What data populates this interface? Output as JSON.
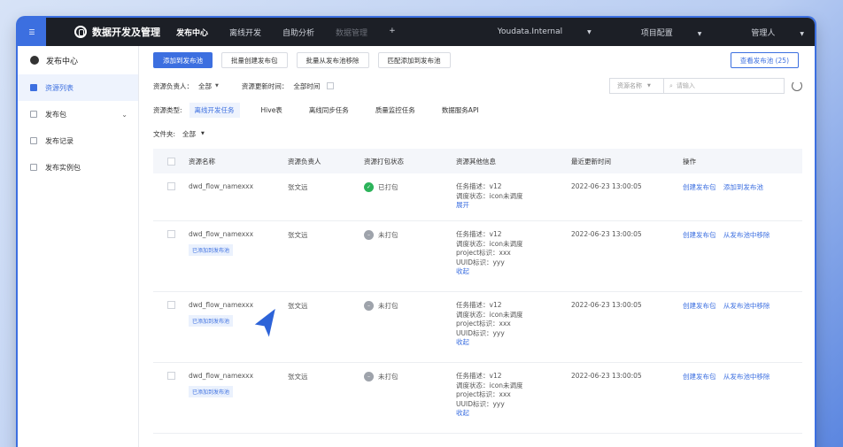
{
  "topbar": {
    "brand": "数据开发及管理",
    "nav": [
      "发布中心",
      "离线开发",
      "自助分析",
      "数据管理",
      "+"
    ],
    "env": "Youdata.Internal",
    "project": "项目配置",
    "user": "管理人"
  },
  "sidebar": {
    "title": "发布中心",
    "items": [
      {
        "label": "资源列表"
      },
      {
        "label": "发布包"
      },
      {
        "label": "发布记录"
      },
      {
        "label": "发布实例包"
      }
    ]
  },
  "toolbar": {
    "add": "添加到发布池",
    "batch_create": "批量创建发布包",
    "batch_remove": "批量从发布池移除",
    "match_add": "匹配添加到发布池",
    "view_pool": "查看发布池 (25)"
  },
  "filters": {
    "owner_label": "资源负责人：",
    "owner_value": "全部",
    "time_label": "资源更新时间：",
    "time_value": "全部时间",
    "search_select": "资源名称",
    "search_placeholder": "请输入"
  },
  "types": {
    "label": "资源类型:",
    "items": [
      "离线开发任务",
      "Hive表",
      "离线同步任务",
      "质量监控任务",
      "数据服务API"
    ]
  },
  "folder": {
    "label": "文件夹:",
    "value": "全部"
  },
  "table": {
    "headers": [
      "资源名称",
      "资源负责人",
      "资源打包状态",
      "资源其他信息",
      "最近更新时间",
      "操作"
    ],
    "rows": [
      {
        "name": "dwd_flow_namexxx",
        "owner": "张文远",
        "status": "已打包",
        "info": [
          "任务描述：v12",
          "调度状态：icon未调度"
        ],
        "toggle": "展开",
        "time": "2022-06-23  13:00:05",
        "ops": [
          "创建发布包",
          "添加到发布池"
        ]
      },
      {
        "name": "dwd_flow_namexxx",
        "tag": "已添加到发布池",
        "owner": "张文远",
        "status": "未打包",
        "info": [
          "任务描述：v12",
          "调度状态：icon未调度",
          "project标识：xxx",
          "UUID标识：yyy"
        ],
        "toggle": "收起",
        "time": "2022-06-23  13:00:05",
        "ops": [
          "创建发布包",
          "从发布池中移除"
        ]
      },
      {
        "name": "dwd_flow_namexxx",
        "tag": "已添加到发布池",
        "owner": "张文远",
        "status": "未打包",
        "info": [
          "任务描述：v12",
          "调度状态：icon未调度",
          "project标识：xxx",
          "UUID标识：yyy"
        ],
        "toggle": "收起",
        "time": "2022-06-23  13:00:05",
        "ops": [
          "创建发布包",
          "从发布池中移除"
        ]
      },
      {
        "name": "dwd_flow_namexxx",
        "tag": "已添加到发布池",
        "owner": "张文远",
        "status": "未打包",
        "info": [
          "任务描述：v12",
          "调度状态：icon未调度",
          "project标识：xxx",
          "UUID标识：yyy"
        ],
        "toggle": "收起",
        "time": "2022-06-23  13:00:05",
        "ops": [
          "创建发布包",
          "从发布池中移除"
        ]
      }
    ]
  },
  "colors": {
    "accent": "#3c6fe0",
    "topbar": "#1c1f26",
    "ok": "#2cb35a",
    "pending": "#9ea3ab"
  }
}
